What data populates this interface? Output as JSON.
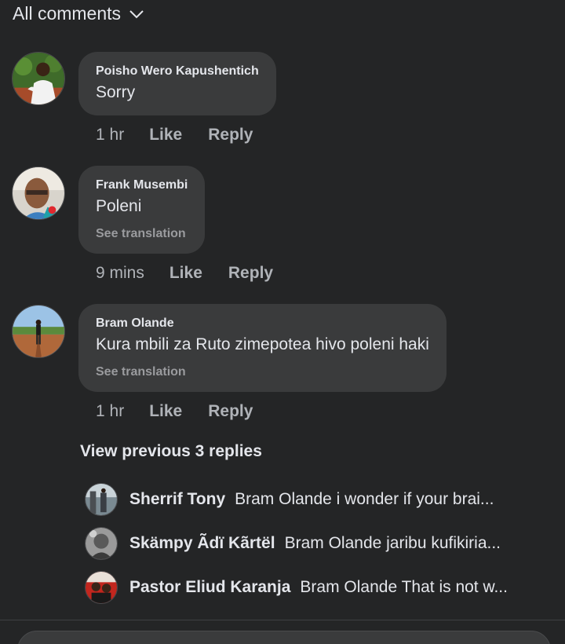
{
  "filter": {
    "label": "All comments",
    "icon": "chevron-down-icon"
  },
  "comments": [
    {
      "author": "Poisho Wero Kapushentich",
      "text": "Sorry",
      "see_translation": "",
      "time": "1 hr",
      "like": "Like",
      "reply": "Reply"
    },
    {
      "author": "Frank Musembi",
      "text": "Poleni",
      "see_translation": "See translation",
      "time": "9 mins",
      "like": "Like",
      "reply": "Reply"
    },
    {
      "author": "Bram Olande",
      "text": "Kura mbili za Ruto zimepotea hivo poleni haki",
      "see_translation": "See translation",
      "time": "1 hr",
      "like": "Like",
      "reply": "Reply"
    }
  ],
  "view_previous": "View previous 3 replies",
  "replies": [
    {
      "name": "Sherrif Tony",
      "text": "Bram Olande i wonder if your brai..."
    },
    {
      "name": "Skämpy Ãdï Kãrtël",
      "text": "Bram Olande jaribu kufikiria..."
    },
    {
      "name": "Pastor Eliud Karanja",
      "text": "Bram Olande That is not w..."
    }
  ],
  "colors": {
    "background": "#242526",
    "bubble": "#3a3b3c",
    "text_primary": "#e4e6eb",
    "text_secondary": "#b0b3b8"
  }
}
